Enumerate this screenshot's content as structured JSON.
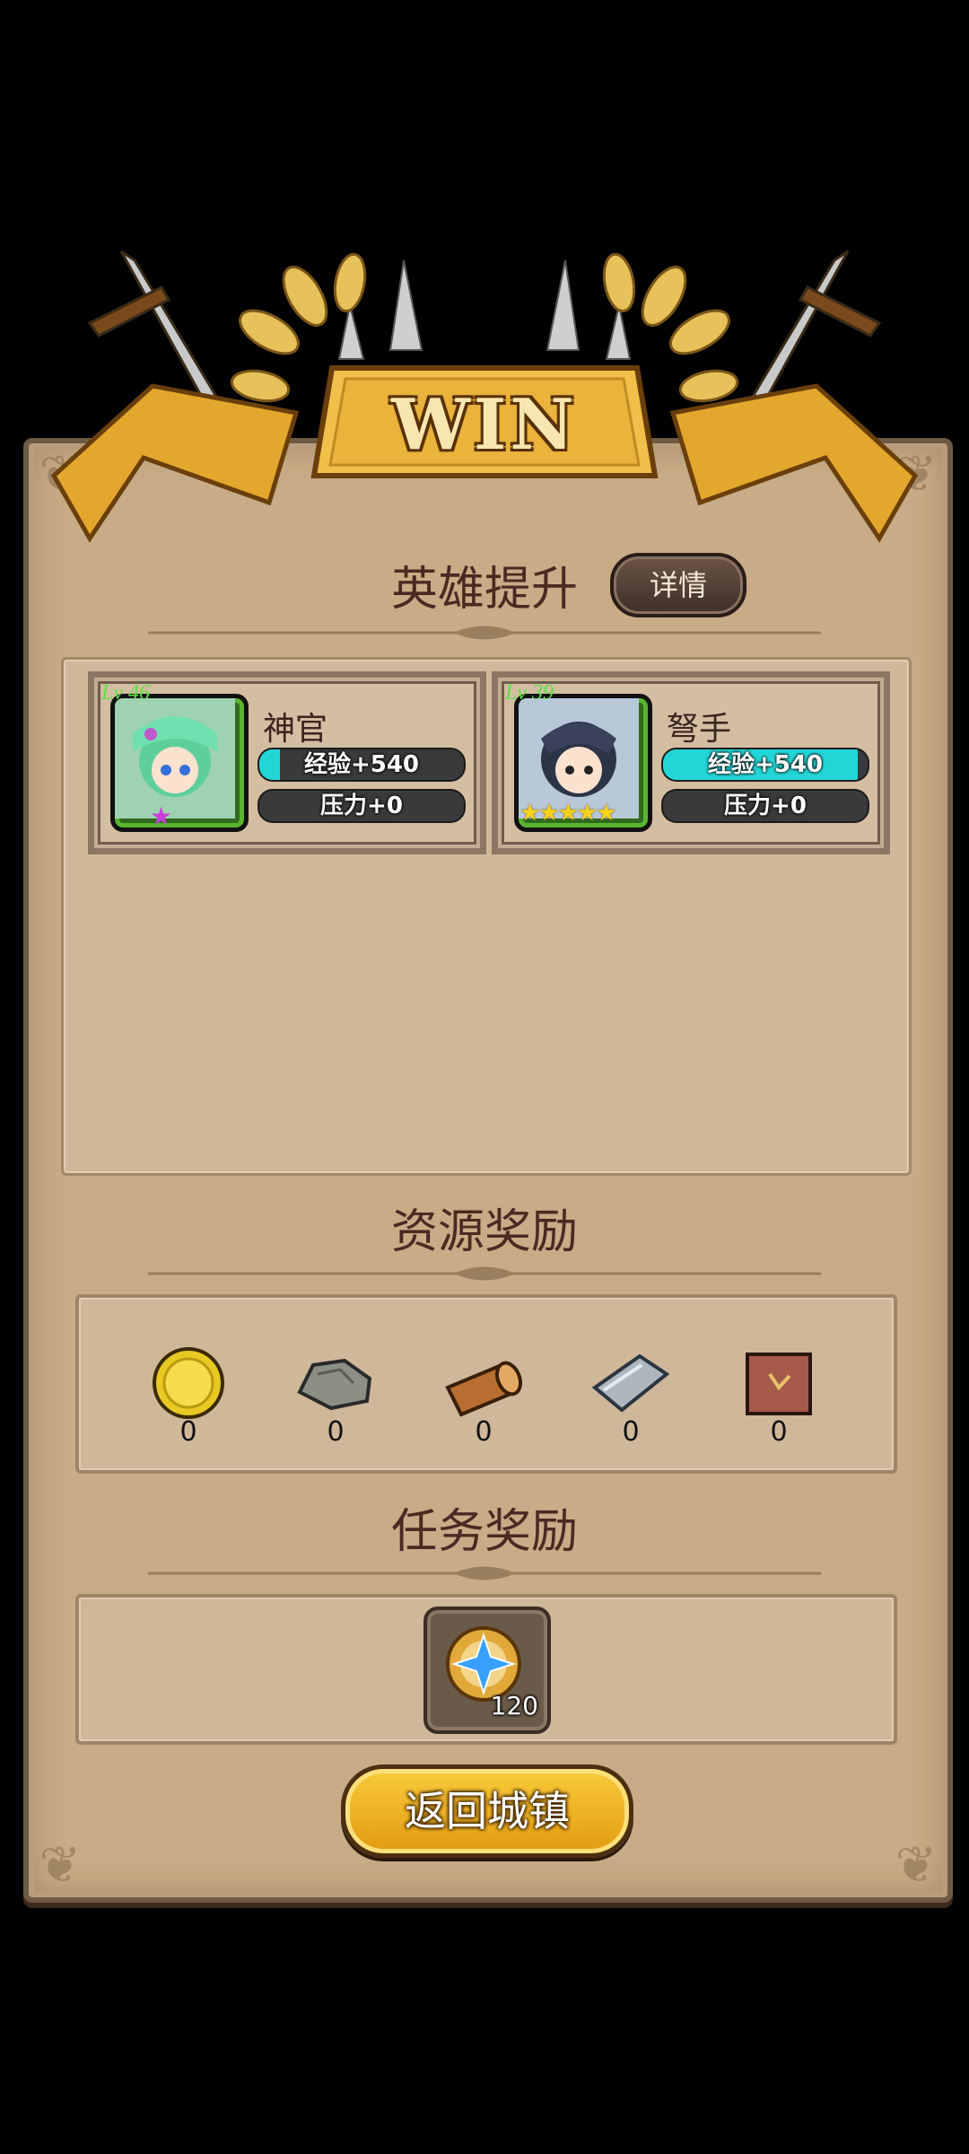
{
  "header": {
    "result_label": "WIN"
  },
  "hero_section": {
    "title": "英雄提升",
    "detail_button": "详情",
    "heroes": [
      {
        "name": "神官",
        "level": "Lv 46",
        "exp": "经验+540",
        "exp_fill": 0.1,
        "stress": "压力+0",
        "stars": 1,
        "star_color": "#c640d8"
      },
      {
        "name": "弩手",
        "level": "Lv 39",
        "exp": "经验+540",
        "exp_fill": 0.95,
        "stress": "压力+0",
        "stars": 5,
        "star_color": "#f6d21c"
      }
    ]
  },
  "resource_section": {
    "title": "资源奖励",
    "items": [
      {
        "icon": "gold-coin-icon",
        "count": "0"
      },
      {
        "icon": "stone-icon",
        "count": "0"
      },
      {
        "icon": "wood-log-icon",
        "count": "0"
      },
      {
        "icon": "iron-ingot-icon",
        "count": "0"
      },
      {
        "icon": "leather-icon",
        "count": "0"
      }
    ]
  },
  "quest_section": {
    "title": "任务奖励",
    "reward": {
      "icon": "star-medal-icon",
      "count": "120"
    }
  },
  "actions": {
    "return_button": "返回城镇"
  },
  "colors": {
    "exp_bar": "#23d6d6",
    "panel": "#c8ac87",
    "banner_gold": "#e8b83a",
    "button_gold": "#f0b020"
  }
}
